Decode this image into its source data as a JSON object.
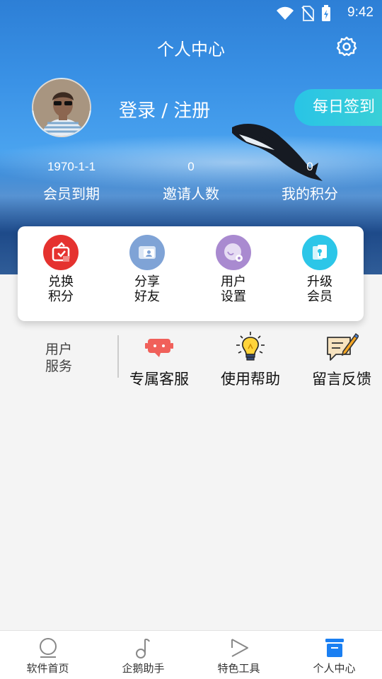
{
  "status_bar": {
    "time": "9:42"
  },
  "header": {
    "title": "个人中心"
  },
  "profile": {
    "login_text": "登录 / 注册",
    "checkin_label": "每日签到"
  },
  "stats": [
    {
      "value": "1970-1-1",
      "label": "会员到期"
    },
    {
      "value": "0",
      "label": "邀请人数"
    },
    {
      "value": "0",
      "label": "我的积分"
    }
  ],
  "card_items": [
    {
      "line1": "兑换",
      "line2": "积分",
      "icon": "redeem-points-icon",
      "color": "#e5322f"
    },
    {
      "line1": "分享",
      "line2": "好友",
      "icon": "share-friends-icon",
      "color": "#7fa3d6"
    },
    {
      "line1": "用户",
      "line2": "设置",
      "icon": "user-settings-icon",
      "color": "#a98ad0"
    },
    {
      "line1": "升级",
      "line2": "会员",
      "icon": "upgrade-member-icon",
      "color": "#2cc6e8"
    }
  ],
  "service": {
    "label_line1": "用户",
    "label_line2": "服务",
    "items": [
      {
        "label": "专属客服",
        "icon": "customer-service-icon"
      },
      {
        "label": "使用帮助",
        "icon": "lightbulb-help-icon"
      },
      {
        "label": "留言反馈",
        "icon": "feedback-note-icon"
      }
    ]
  },
  "tabbar": [
    {
      "label": "软件首页",
      "icon": "home-circle-icon"
    },
    {
      "label": "企鹅助手",
      "icon": "music-note-icon"
    },
    {
      "label": "特色工具",
      "icon": "play-triangle-icon"
    },
    {
      "label": "个人中心",
      "icon": "profile-box-icon",
      "active": true
    }
  ],
  "colors": {
    "accent": "#1a7ff2",
    "checkin_gradient_start": "#29c4e6"
  }
}
